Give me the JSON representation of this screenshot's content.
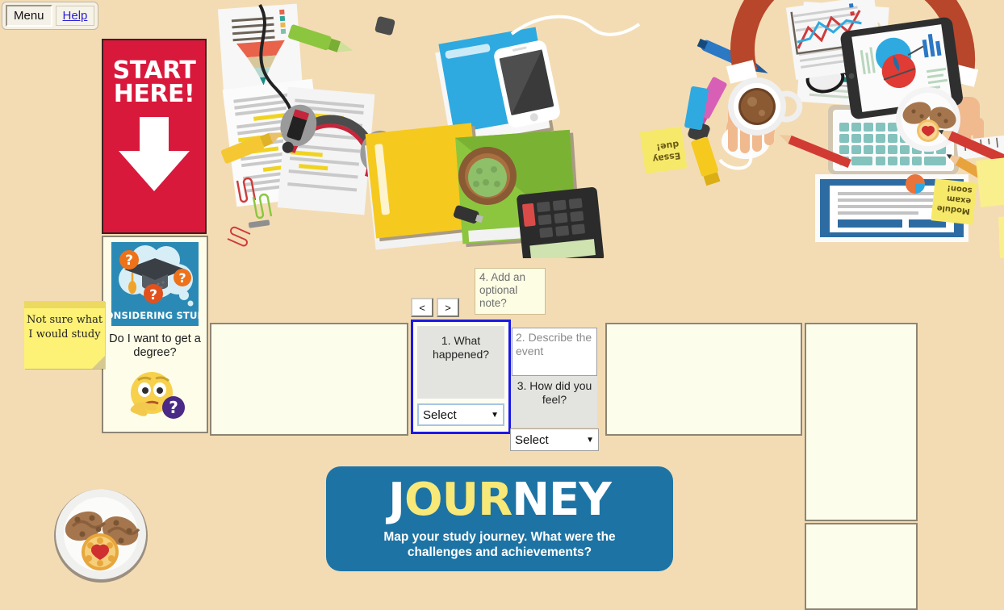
{
  "background_color": "#f3dcb4",
  "toolbar": {
    "menu_label": "Menu",
    "help_label": "Help"
  },
  "start_banner": {
    "line1": "START",
    "line2": "HERE!",
    "arrow_icon": "down-arrow-icon",
    "color": "#d8193c"
  },
  "sticky_note": {
    "text": "Not sure what I would study",
    "color": "#fdf176"
  },
  "considering_card": {
    "image_label": "CONSIDERING STUDY",
    "image_icon": "graduation-cap-thought-cloud-icon",
    "caption": "Do I want to get a degree?",
    "emoji_icon": "thinking-face-question-icon"
  },
  "nav": {
    "prev_label": "<",
    "next_label": ">"
  },
  "form": {
    "q1_label": "1. What happened?",
    "q1_select_value": "Select",
    "q2_placeholder": "2. Describe the event",
    "q2_value": "",
    "q3_label": "3. How did you feel?",
    "q3_select_value": "Select",
    "q4_label": "4. Add an optional note?",
    "focus_color": "#1a19e8",
    "caret_icon": "chevron-down-icon"
  },
  "panels": {
    "empty_label": ""
  },
  "journey_banner": {
    "title_part1": "J",
    "title_part2": "OUR",
    "title_part3": "NEY",
    "subtitle": "Map your study journey. What were the challenges and achievements?",
    "bg_color": "#1d74a4",
    "accent_color": "#f8e877"
  },
  "desk_illustration": {
    "alt": "flat-illustration top-down desk with hands typing on laptop, papers, charts, headphones, folders, coffee, cookies, tablet, calculator, pencils, paperclips, sticky notes",
    "sticky_note_1": "Essay due!",
    "sticky_note_2": "Module exam soon!"
  },
  "cookie_plate": {
    "icon": "plate-of-cookies-icon"
  }
}
